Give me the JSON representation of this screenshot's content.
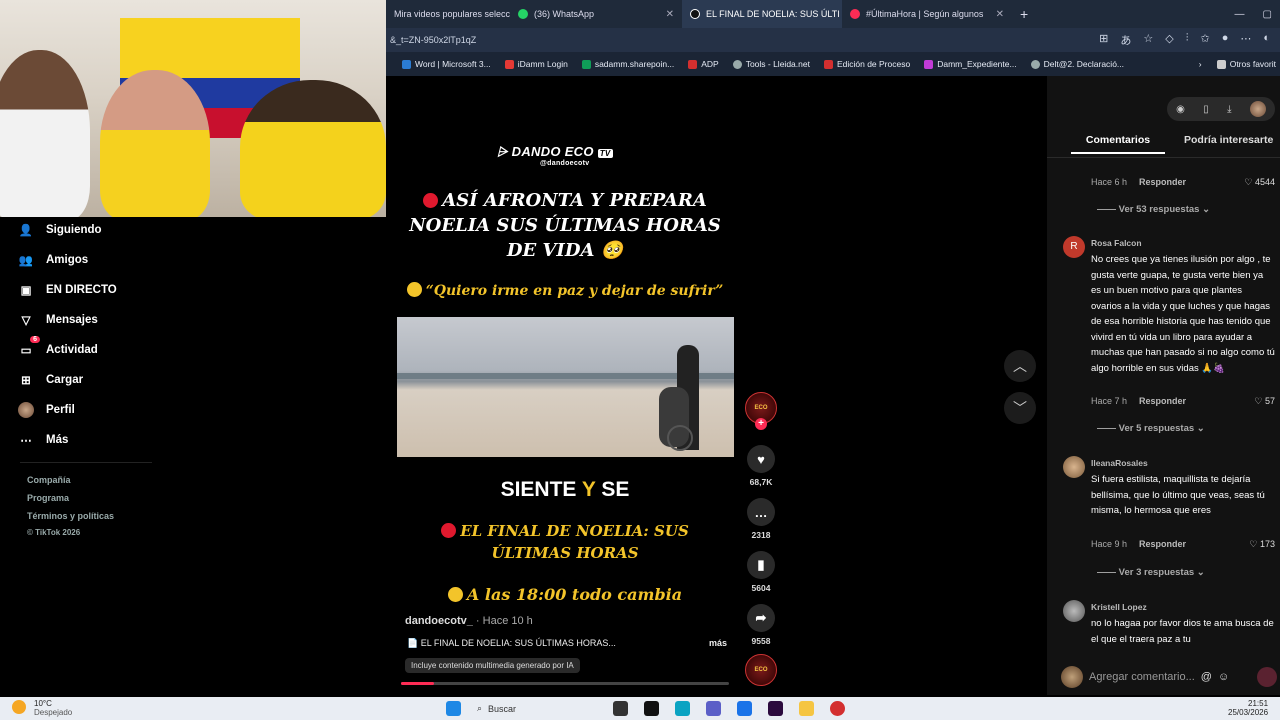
{
  "browser": {
    "tabs": [
      {
        "label": "Mira videos populares seleccio",
        "color": "#ffffff",
        "active": false
      },
      {
        "label": "(36) WhatsApp",
        "color": "#25d366",
        "active": false
      },
      {
        "label": "EL FINAL DE NOELIA: SUS ÚLTI",
        "color": "#ffffff",
        "active": true
      },
      {
        "label": "#ÚltimaHora | Según algunos",
        "color": "#fe2c55",
        "active": false
      }
    ],
    "url": "&_t=ZN-950x2lTp1qZ",
    "bookmarks": [
      "Word | Microsoft 3...",
      "iDamm Login",
      "sadamm.sharepoin...",
      "ADP",
      "Tools - Lleida.net",
      "Edición de Proceso",
      "Damm_Expediente...",
      "Delt@2. Declaració...",
      "Otros favorit"
    ]
  },
  "nav": {
    "items": [
      {
        "label": "Siguiendo",
        "icon": "following-icon"
      },
      {
        "label": "Amigos",
        "icon": "friends-icon"
      },
      {
        "label": "EN DIRECTO",
        "icon": "live-icon"
      },
      {
        "label": "Mensajes",
        "icon": "messages-icon"
      },
      {
        "label": "Actividad",
        "icon": "activity-icon",
        "badge": "6"
      },
      {
        "label": "Cargar",
        "icon": "upload-icon"
      },
      {
        "label": "Perfil",
        "icon": "profile-icon"
      },
      {
        "label": "Más",
        "icon": "more-icon"
      }
    ],
    "footer": [
      "Compañía",
      "Programa",
      "Términos y políticas",
      "© TikTok 2026"
    ]
  },
  "video": {
    "logo": "DANDO ECO",
    "logo_badge": "TV",
    "logo_handle": "@dandoecotv",
    "headline": [
      "ASÍ AFRONTA Y PREPARA",
      "NOELIA SUS ÚLTIMAS HORAS",
      "DE VIDA 🥺"
    ],
    "quote": "“Quiero irme en paz y dejar de sufrir”",
    "siente_a": "SIENTE",
    "siente_b": "Y",
    "siente_c": "SE",
    "final": [
      "EL FINAL DE NOELIA: SUS",
      "ÚLTIMAS HORAS"
    ],
    "cambia": "A las 18:00 todo cambia",
    "author": "dandoecotv_",
    "time": "· Hace 10 h",
    "caption": "📄 EL FINAL DE NOELIA: SUS ÚLTIMAS HORAS...",
    "more": "más",
    "ai_label": "Incluye contenido multimedia generado por IA",
    "progress": 0.1
  },
  "actions": {
    "likes": "68,7K",
    "comments": "2318",
    "saves": "5604",
    "shares": "9558"
  },
  "panel": {
    "tab_comments": "Comentarios",
    "tab_interest": "Podría interesarte",
    "c0": {
      "time": "Hace 6 h",
      "reply": "Responder",
      "likes": "4544",
      "more": "Ver 53 respuestas"
    },
    "c1": {
      "name": "Rosa Falcon",
      "avatar_letter": "R",
      "text": "No crees que ya tienes ilusión por algo , te gusta verte guapa, te gusta verte bien ya es un buen motivo para que plantes ovarios a la vida y que luches y que hagas de esa horrible historia que has tenido que vivird en tú vida un libro para ayudar a muchas que han pasado si no algo como tú algo horrible en sus vidas 🙏🍇",
      "time": "Hace 7 h",
      "reply": "Responder",
      "likes": "57",
      "more": "Ver 5 respuestas"
    },
    "c2": {
      "name": "IleanaRosales",
      "text": "Si fuera estilista, maquillista te dejaría bellísima, que lo último que veas, seas tú misma, lo hermosa que eres",
      "time": "Hace 9 h",
      "reply": "Responder",
      "likes": "173",
      "more": "Ver 3 respuestas"
    },
    "c3": {
      "name": "Kristell Lopez",
      "text": "no lo hagaa por favor dios te ama busca de el que el traera paz a tu"
    },
    "input_placeholder": "Agregar comentario..."
  },
  "taskbar": {
    "temp": "10°C",
    "weather": "Despejado",
    "search": "Buscar",
    "clock": "21:51",
    "date": "25/03/2026"
  }
}
